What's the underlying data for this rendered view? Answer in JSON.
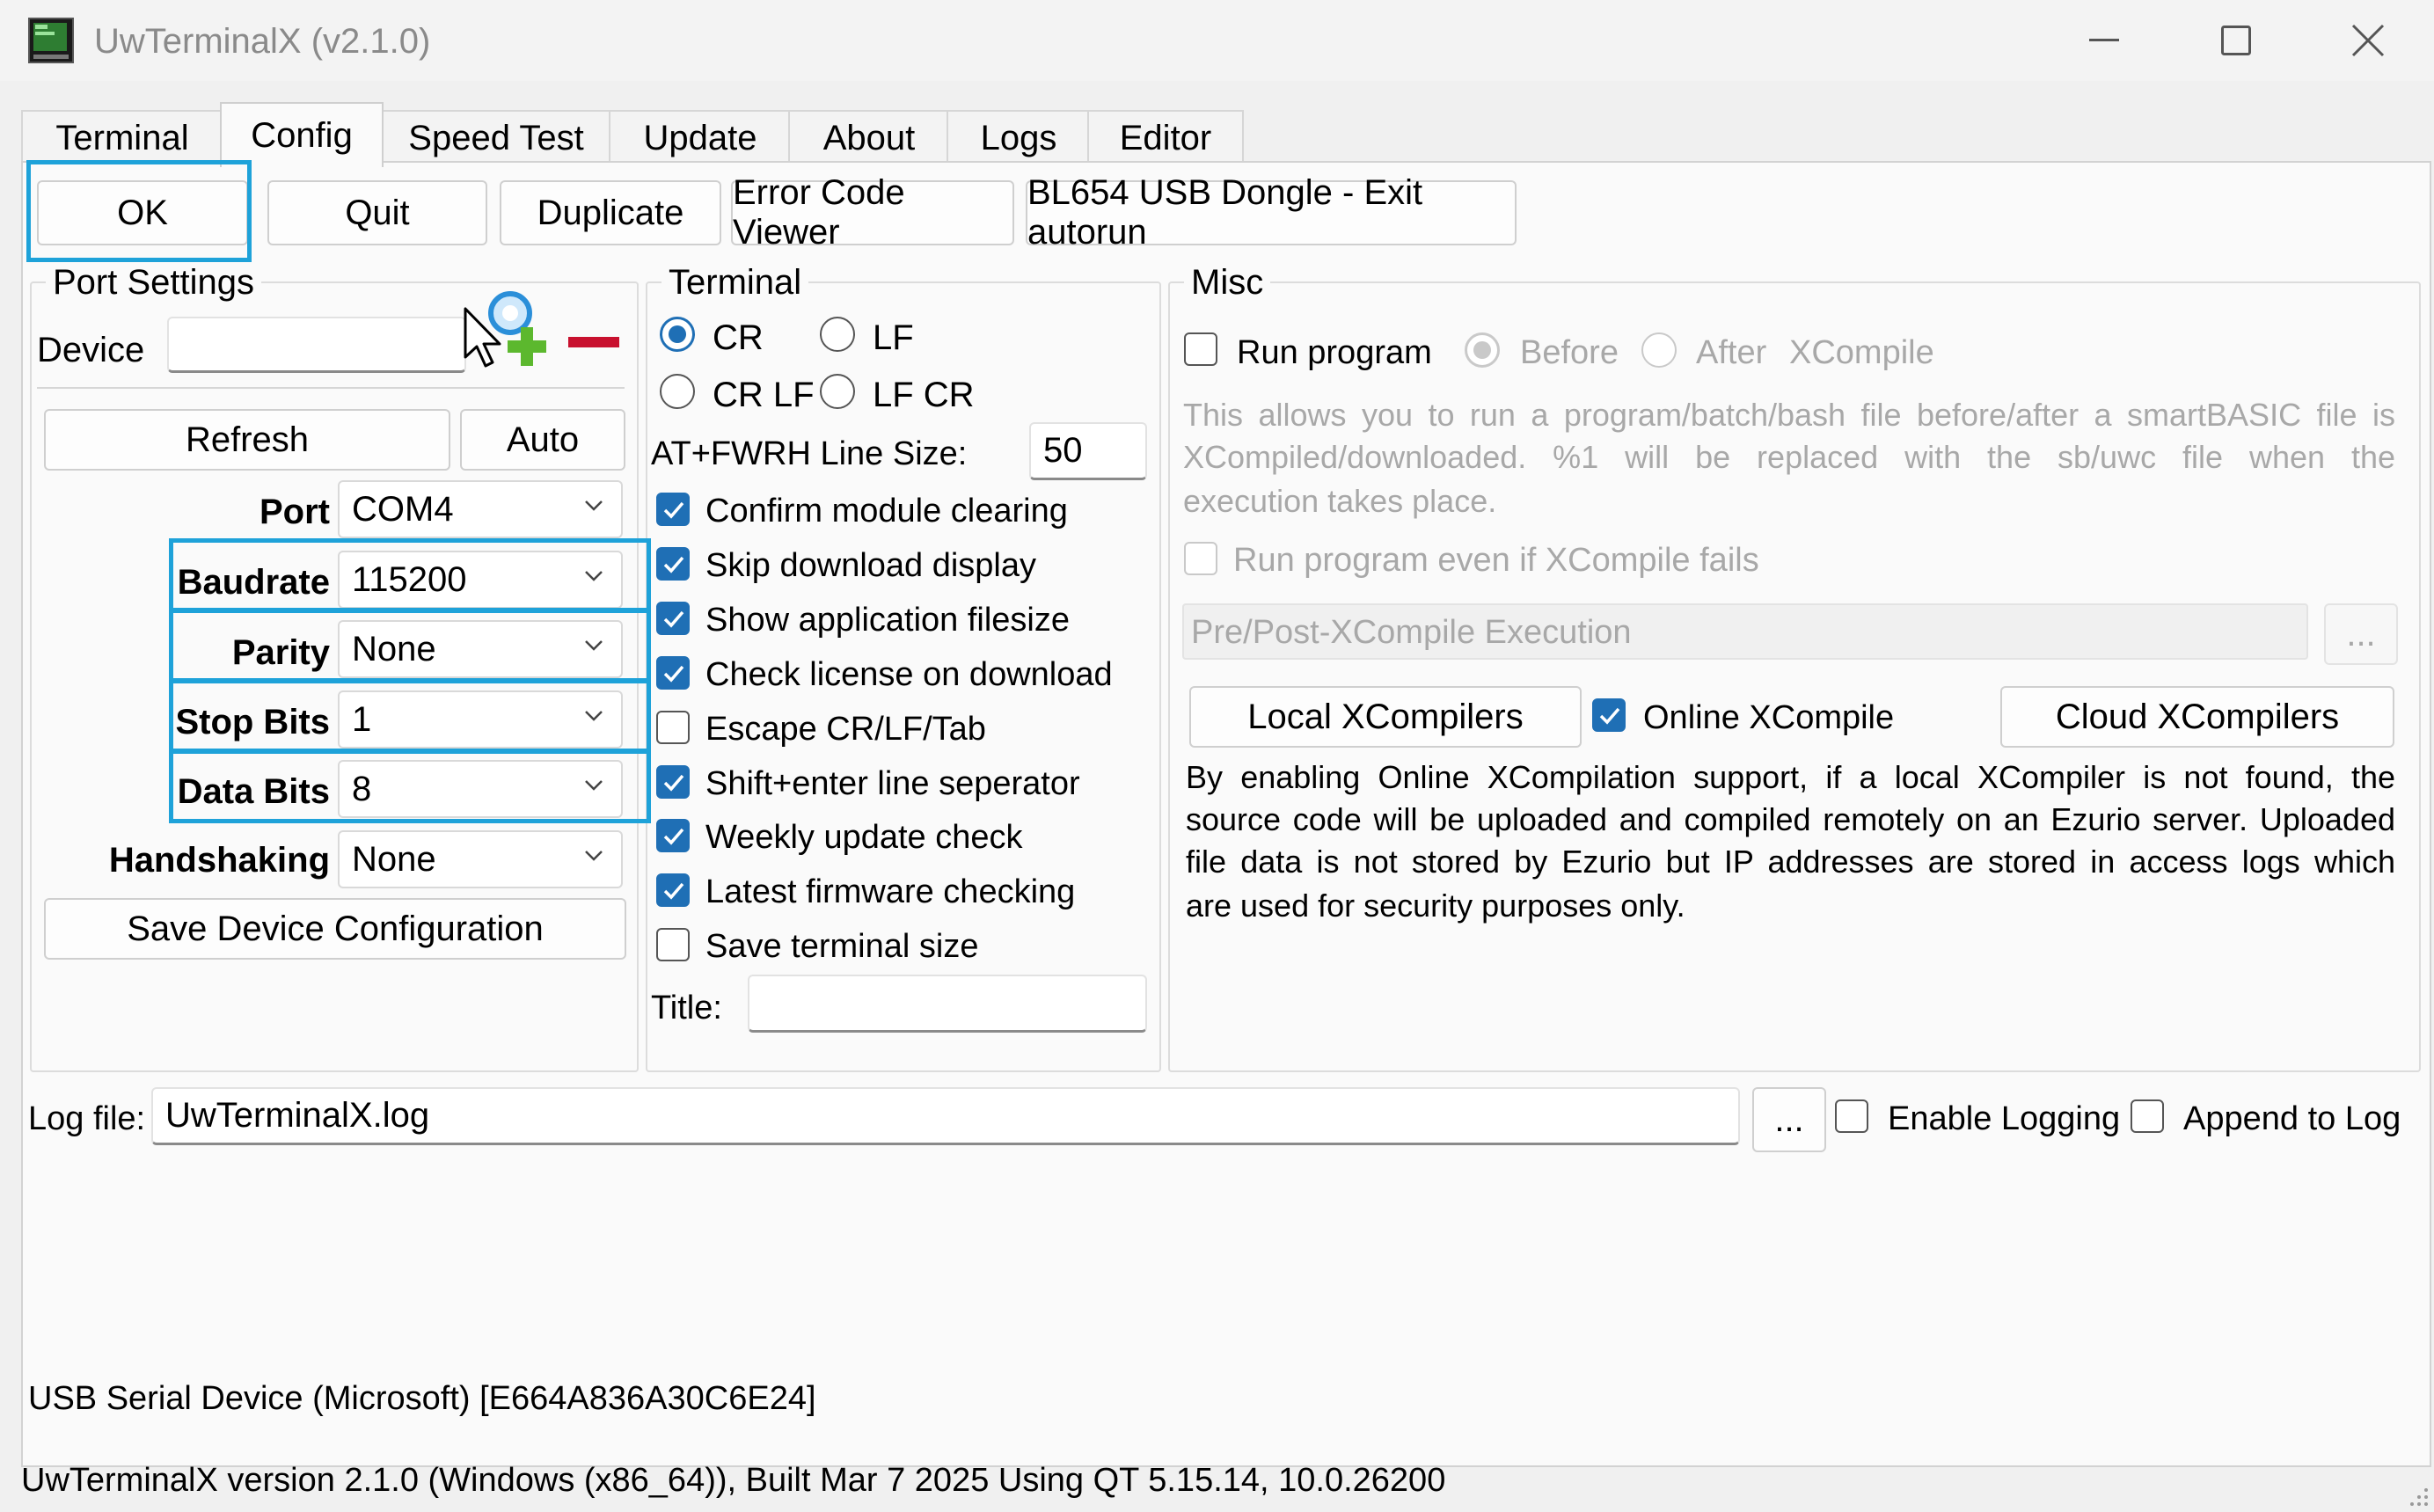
{
  "window": {
    "title": "UwTerminalX (v2.1.0)"
  },
  "tabs": [
    "Terminal",
    "Config",
    "Speed Test",
    "Update",
    "About",
    "Logs",
    "Editor"
  ],
  "toolbar": {
    "ok": "OK",
    "quit": "Quit",
    "duplicate": "Duplicate",
    "error_code_viewer": "Error Code Viewer",
    "exit_autorun": "BL654 USB Dongle - Exit autorun"
  },
  "port_settings": {
    "title": "Port Settings",
    "device_label": "Device",
    "device_value": "",
    "refresh": "Refresh",
    "auto": "Auto",
    "port_label": "Port",
    "port_value": "COM4",
    "baudrate_label": "Baudrate",
    "baudrate_value": "115200",
    "parity_label": "Parity",
    "parity_value": "None",
    "stopbits_label": "Stop Bits",
    "stopbits_value": "1",
    "databits_label": "Data Bits",
    "databits_value": "8",
    "handshaking_label": "Handshaking",
    "handshaking_value": "None",
    "save": "Save Device Configuration"
  },
  "terminal": {
    "title": "Terminal",
    "radio_cr": "CR",
    "radio_lf": "LF",
    "radio_crlf": "CR LF",
    "radio_lfcr": "LF CR",
    "selected_line_ending": "CR",
    "line_size_label": "AT+FWRH Line Size:",
    "line_size_value": "50",
    "options": [
      {
        "label": "Confirm module clearing",
        "checked": true
      },
      {
        "label": "Skip download display",
        "checked": true
      },
      {
        "label": "Show application filesize",
        "checked": true
      },
      {
        "label": "Check license on download",
        "checked": true
      },
      {
        "label": "Escape CR/LF/Tab",
        "checked": false
      },
      {
        "label": "Shift+enter line seperator",
        "checked": true
      },
      {
        "label": "Weekly update check",
        "checked": true
      },
      {
        "label": "Latest firmware checking",
        "checked": true
      },
      {
        "label": "Save terminal size",
        "checked": false
      }
    ],
    "title_label": "Title:",
    "title_value": ""
  },
  "misc": {
    "title": "Misc",
    "run_program": "Run program",
    "before": "Before",
    "after": "After",
    "xcompile": "XCompile",
    "run_desc": [
      "This allows you to run a program/batch/bash file before/after a smartBASIC file is",
      "XCompiled/downloaded. %1 will be replaced with the sb/uwc file when the",
      "execution takes place."
    ],
    "run_even_if_fails": "Run program even if XCompile fails",
    "exec_placeholder": "Pre/Post-XCompile Execution",
    "browse": "...",
    "local_xcompilers": "Local XCompilers",
    "online_xcompile": "Online XCompile",
    "cloud_xcompilers": "Cloud XCompilers",
    "online_desc": [
      "By enabling Online XCompilation support, if a local XCompiler is not found, the",
      "source code will be uploaded and compiled remotely on an Ezurio server. Uploaded",
      "file data is not stored by Ezurio but IP addresses are stored in access logs which",
      "are used for security purposes only."
    ]
  },
  "log": {
    "label": "Log file:",
    "value": "UwTerminalX.log",
    "browse": "...",
    "enable_logging": "Enable Logging",
    "append_to_log": "Append to Log"
  },
  "device_info": "USB Serial Device (Microsoft) [E664A836A30C6E24]",
  "status_bar": "UwTerminalX version 2.1.0 (Windows (x86_64)), Built Mar  7 2025 Using QT 5.15.14, 10.0.26200",
  "colors": {
    "accent": "#1f6fb5",
    "highlight": "#1ea2d9",
    "remove_icon": "#c8102e",
    "add_icon": "#5cb82e"
  }
}
